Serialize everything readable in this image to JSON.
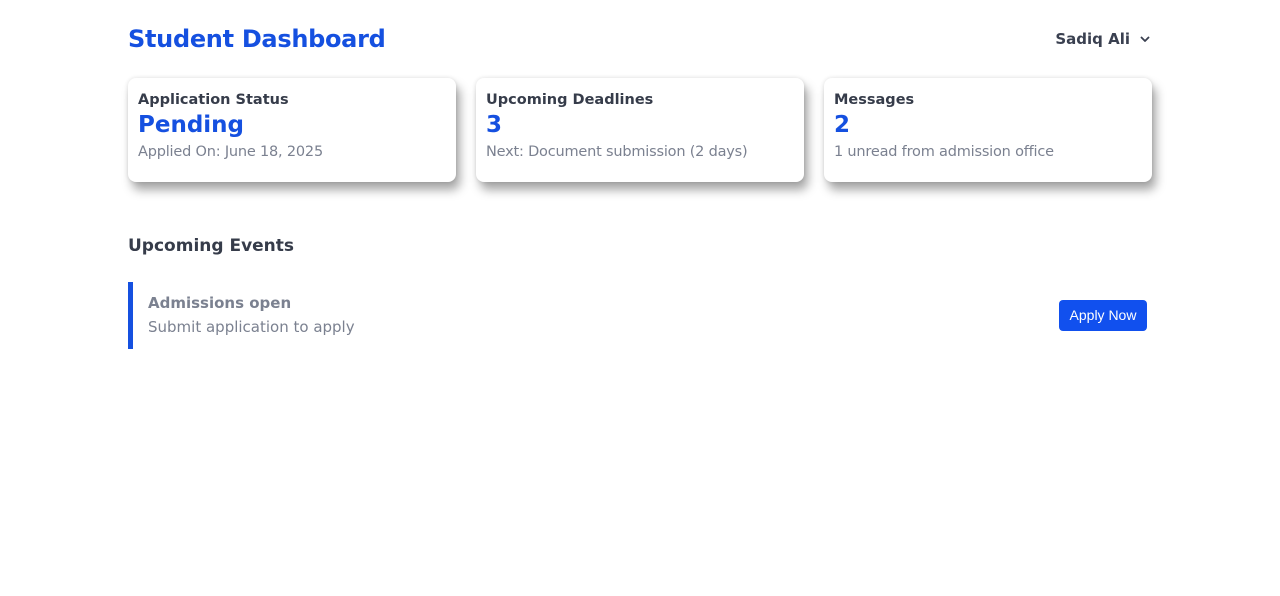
{
  "header": {
    "title": "Student Dashboard",
    "user_name": "Sadiq Ali"
  },
  "cards": [
    {
      "label": "Application Status",
      "value": "Pending",
      "sub": "Applied On: June 18, 2025"
    },
    {
      "label": "Upcoming Deadlines",
      "value": "3",
      "sub": "Next: Document submission (2 days)"
    },
    {
      "label": "Messages",
      "value": "2",
      "sub": "1 unread from admission office"
    }
  ],
  "events": {
    "heading": "Upcoming Events",
    "items": [
      {
        "title": "Admissions open",
        "description": "Submit application to apply",
        "action_label": "Apply Now"
      }
    ]
  },
  "colors": {
    "accent": "#1550e0",
    "button": "#1150ee",
    "heading_text": "#363c4a",
    "muted_text": "#7b8190"
  },
  "icons": {
    "user_menu": "chevron-down-icon"
  }
}
